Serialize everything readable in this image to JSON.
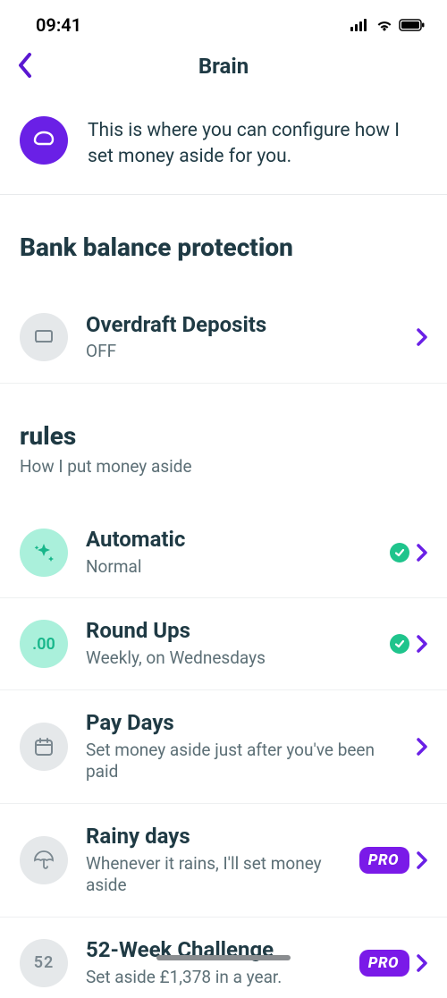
{
  "status": {
    "time": "09:41"
  },
  "header": {
    "title": "Brain"
  },
  "intro": {
    "text": "This is where you can configure how I set money aside for you."
  },
  "sections": {
    "balance": {
      "title": "Bank balance protection",
      "overdraft": {
        "title": "Overdraft Deposits",
        "status": "OFF"
      }
    },
    "rules": {
      "title": "rules",
      "subtitle": "How I put money aside",
      "automatic": {
        "title": "Automatic",
        "sub": "Normal"
      },
      "roundups": {
        "title": "Round Ups",
        "sub": "Weekly, on Wednesdays"
      },
      "paydays": {
        "title": "Pay Days",
        "sub": "Set money aside just after you've been paid"
      },
      "rainy": {
        "title": "Rainy days",
        "sub": "Whenever it rains, I'll set money aside",
        "badge": "PRO"
      },
      "challenge": {
        "title": "52-Week Challenge",
        "sub": "Set aside £1,378 in a year.",
        "badge": "PRO",
        "iconLabel": "52"
      }
    }
  },
  "colors": {
    "accent": "#6a20e6",
    "green": "#1fc48c"
  }
}
